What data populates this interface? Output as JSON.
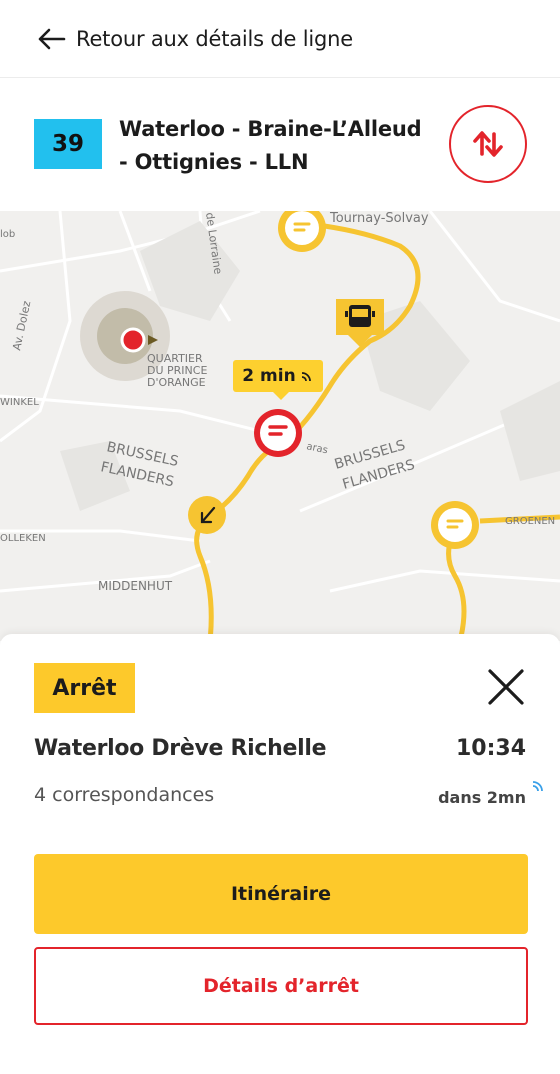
{
  "nav": {
    "back_label": "Retour aux détails de ligne"
  },
  "line": {
    "number": "39",
    "name": "Waterloo - Braine-L’Alleud - Ottignies - LLN",
    "badge_color": "#22c0ee"
  },
  "map": {
    "labels": {
      "tournay": "Tournay-Solvay",
      "lorraine": "de Lorraine",
      "dolez": "Av. Dolez",
      "quartier1": "QUARTIER",
      "quartier2": "DU PRINCE",
      "quartier3": "D'ORANGE",
      "winkel": "WINKEL",
      "brussels1": "BRUSSELS",
      "flanders1": "FLANDERS",
      "brussels2": "BRUSSELS",
      "flanders2": "FLANDERS",
      "groenen": "GROENEN",
      "olleken": "OLLEKEN",
      "middenhut": "MIDDENHUT",
      "lob": "lob",
      "aras": "aras"
    },
    "eta": "2 min"
  },
  "stop": {
    "tag": "Arrêt",
    "name": "Waterloo Drève Richelle",
    "time": "10:34",
    "connections": "4 correspondances",
    "due_in": "dans 2mn"
  },
  "actions": {
    "primary": "Itinéraire",
    "secondary": "Détails d’arrêt"
  },
  "colors": {
    "accent_yellow": "#fdc92b",
    "accent_red": "#e3242b",
    "route": "#f6c431"
  }
}
